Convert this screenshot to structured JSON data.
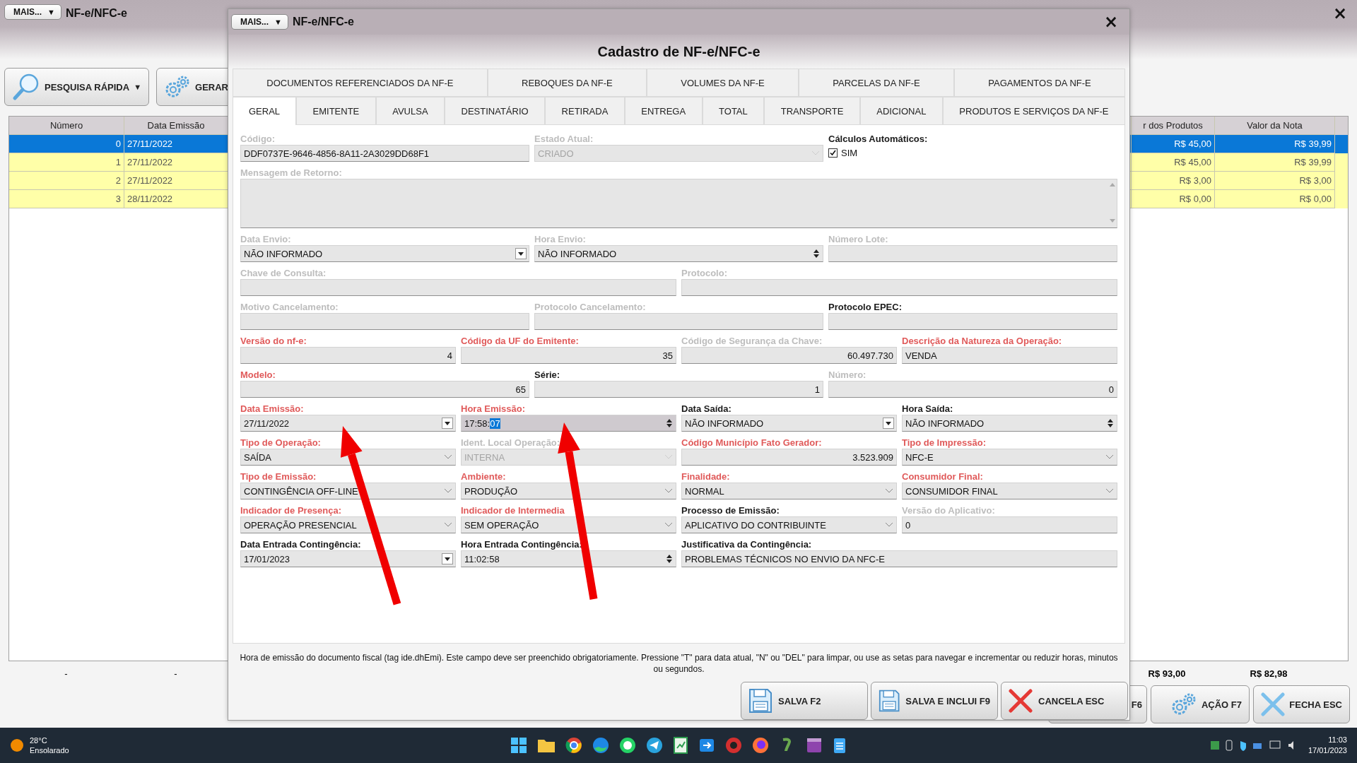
{
  "background_window": {
    "menu_button": "MAIS...",
    "menu_caret": "▼",
    "title": "NF-e/NFC-e",
    "close": "×",
    "toolbar": [
      {
        "kind": "search",
        "label": "PESQUISA RÁPIDA",
        "caret": "▼"
      },
      {
        "kind": "gear",
        "label": "GERAR"
      }
    ],
    "table": {
      "columns": [
        "Número",
        "Data Emissão",
        "r dos Produtos",
        "Valor da Nota"
      ],
      "rows": [
        {
          "number": "0",
          "date": "27/11/2022",
          "products": "R$ 45,00",
          "total": "R$ 39,99",
          "selected": true
        },
        {
          "number": "1",
          "date": "27/11/2022",
          "products": "R$ 45,00",
          "total": "R$ 39,99",
          "selected": false
        },
        {
          "number": "2",
          "date": "27/11/2022",
          "products": "R$ 3,00",
          "total": "R$ 3,00",
          "selected": false
        },
        {
          "number": "3",
          "date": "28/11/2022",
          "products": "R$ 0,00",
          "total": "R$ 0,00",
          "selected": false
        }
      ]
    },
    "totals": [
      "-",
      "-",
      "R$ 93,00",
      "R$ 82,98"
    ],
    "buttons": [
      {
        "kind": "plain",
        "label": "F6"
      },
      {
        "kind": "gear",
        "label": "AÇÃO F7"
      },
      {
        "kind": "close",
        "label": "FECHA ESC"
      }
    ]
  },
  "dialog": {
    "menu_button": "MAIS...",
    "menu_caret": "▼",
    "title": "NF-e/NFC-e",
    "close": "×",
    "heading": "Cadastro de NF-e/NFC-e",
    "tabs_top": [
      {
        "label": "DOCUMENTOS REFERENCIADOS DA NF-E",
        "selected": false
      },
      {
        "label": "REBOQUES DA NF-E",
        "selected": false
      },
      {
        "label": "VOLUMES DA NF-E",
        "selected": false
      },
      {
        "label": "PARCELAS DA NF-E",
        "selected": false
      },
      {
        "label": "PAGAMENTOS DA NF-E",
        "selected": false
      }
    ],
    "tabs": [
      {
        "label": "GERAL",
        "selected": true
      },
      {
        "label": "EMITENTE",
        "selected": false
      },
      {
        "label": "AVULSA",
        "selected": false
      },
      {
        "label": "DESTINATÁRIO",
        "selected": false
      },
      {
        "label": "RETIRADA",
        "selected": false
      },
      {
        "label": "ENTREGA",
        "selected": false
      },
      {
        "label": "TOTAL",
        "selected": false
      },
      {
        "label": "TRANSPORTE",
        "selected": false
      },
      {
        "label": "ADICIONAL",
        "selected": false
      },
      {
        "label": "PRODUTOS E SERVIÇOS DA NF-E",
        "selected": false
      }
    ],
    "form_rows": [
      [
        {
          "label": {
            "text": "Código:",
            "kind": "disabled"
          },
          "kind": "text",
          "value": "DDF0737E-9646-4856-8A11-2A3029DD68F1"
        },
        {
          "label": {
            "text": "Estado Atual:",
            "kind": "disabled"
          },
          "kind": "combo",
          "value": "CRIADO",
          "disabled": true
        },
        {
          "label": {
            "text": "Cálculos Automáticos:",
            "kind": "normal"
          },
          "kind": "checkbox",
          "option": "SIM",
          "checked": true
        }
      ],
      [
        {
          "label": {
            "text": "Mensagem de Retorno:",
            "kind": "disabled"
          },
          "kind": "memo"
        }
      ],
      [
        {
          "label": {
            "text": "Data Envio:",
            "kind": "disabled"
          },
          "kind": "date",
          "value": "NÃO INFORMADO"
        },
        {
          "label": {
            "text": "Hora Envio:",
            "kind": "disabled"
          },
          "kind": "spin",
          "value": "NÃO INFORMADO"
        },
        {
          "label": {
            "text": "Número Lote:",
            "kind": "disabled"
          },
          "kind": "text"
        }
      ],
      [
        {
          "label": {
            "text": "Chave de Consulta:",
            "kind": "disabled"
          },
          "kind": "text"
        },
        {
          "label": {
            "text": "Protocolo:",
            "kind": "disabled"
          },
          "kind": "text"
        }
      ],
      [
        {
          "label": {
            "text": "Motivo Cancelamento:",
            "kind": "disabled"
          },
          "kind": "text"
        },
        {
          "label": {
            "text": "Protocolo Cancelamento:",
            "kind": "disabled"
          },
          "kind": "text"
        },
        {
          "label": {
            "text": "Protocolo EPEC:",
            "kind": "normal"
          },
          "kind": "text"
        }
      ],
      [
        {
          "label": {
            "text": "Versão do nf-e:",
            "kind": "required"
          },
          "kind": "number",
          "value": "4"
        },
        {
          "label": {
            "text": "Código da UF do Emitente:",
            "kind": "required"
          },
          "kind": "number",
          "value": "35"
        },
        {
          "label": {
            "text": "Código de Segurança da Chave:",
            "kind": "disabled"
          },
          "kind": "number",
          "value": "60.497.730"
        },
        {
          "label": {
            "text": "Descrição da Natureza da Operação:",
            "kind": "required"
          },
          "kind": "text",
          "value": "VENDA"
        }
      ],
      [
        {
          "label": {
            "text": "Modelo:",
            "kind": "required"
          },
          "kind": "number",
          "value": "65"
        },
        {
          "label": {
            "text": "Série:",
            "kind": "normal"
          },
          "kind": "number",
          "value": "1"
        },
        {
          "label": {
            "text": "Número:",
            "kind": "disabled"
          },
          "kind": "number",
          "value": "0"
        }
      ],
      [
        {
          "label": {
            "text": "Data Emissão:",
            "kind": "required"
          },
          "kind": "date",
          "value": "27/11/2022"
        },
        {
          "label": {
            "text": "Hora Emissão:",
            "kind": "required"
          },
          "kind": "spin",
          "value": "17:58:",
          "selection": "07",
          "focused": true
        },
        {
          "label": {
            "text": "Data Saída:",
            "kind": "normal"
          },
          "kind": "date",
          "value": "NÃO INFORMADO"
        },
        {
          "label": {
            "text": "Hora Saída:",
            "kind": "normal"
          },
          "kind": "spin",
          "value": "NÃO INFORMADO"
        }
      ],
      [
        {
          "label": {
            "text": "Tipo de Operação:",
            "kind": "required"
          },
          "kind": "combo",
          "value": "SAÍDA"
        },
        {
          "label": {
            "text": "Ident. Local Operação:",
            "kind": "disabled"
          },
          "kind": "combo",
          "value": "INTERNA",
          "disabled": true
        },
        {
          "label": {
            "text": "Código Município Fato Gerador:",
            "kind": "required"
          },
          "kind": "number",
          "value": "3.523.909"
        },
        {
          "label": {
            "text": "Tipo de Impressão:",
            "kind": "required"
          },
          "kind": "combo",
          "value": "NFC-E"
        }
      ],
      [
        {
          "label": {
            "text": "Tipo de Emissão:",
            "kind": "required"
          },
          "kind": "combo",
          "value": "CONTINGÊNCIA OFF-LINE"
        },
        {
          "label": {
            "text": "Ambiente:",
            "kind": "required"
          },
          "kind": "combo",
          "value": "PRODUÇÃO"
        },
        {
          "label": {
            "text": "Finalidade:",
            "kind": "required"
          },
          "kind": "combo",
          "value": "NORMAL"
        },
        {
          "label": {
            "text": "Consumidor Final:",
            "kind": "required"
          },
          "kind": "combo",
          "value": "CONSUMIDOR FINAL"
        }
      ],
      [
        {
          "label": {
            "text": "Indicador de Presença:",
            "kind": "required"
          },
          "kind": "combo",
          "value": "OPERAÇÃO PRESENCIAL"
        },
        {
          "label": {
            "text": "Indicador de Intermedia",
            "kind": "required"
          },
          "kind": "combo",
          "value": "SEM OPERAÇÃO"
        },
        {
          "label": {
            "text": "Processo de Emissão:",
            "kind": "normal"
          },
          "kind": "combo",
          "value": "APLICATIVO DO CONTRIBUINTE"
        },
        {
          "label": {
            "text": "Versão do Aplicativo:",
            "kind": "disabled"
          },
          "kind": "text",
          "value": "0"
        }
      ],
      [
        {
          "label": {
            "text": "Data Entrada Contingência:",
            "kind": "normal"
          },
          "kind": "date",
          "value": "17/01/2023"
        },
        {
          "label": {
            "text": "Hora Entrada Contingência:",
            "kind": "normal"
          },
          "kind": "spin",
          "value": "11:02:58"
        },
        {
          "label": {
            "text": "Justificativa da Contingência:",
            "kind": "normal"
          },
          "kind": "text",
          "value": "PROBLEMAS TÉCNICOS NO ENVIO DA NFC-E",
          "wide": true
        }
      ]
    ],
    "help": "Hora de emissão do documento fiscal (tag ide.dhEmi). Este campo deve ser preenchido obrigatoriamente. Pressione \"T\" para data atual, \"N\" ou \"DEL\" para limpar, ou use as setas para navegar e incrementar ou reduzir horas, minutos ou segundos.",
    "buttons": [
      {
        "kind": "save",
        "label": "SALVA F2"
      },
      {
        "kind": "save",
        "label": "SALVA E INCLUI F9"
      },
      {
        "kind": "cancel",
        "label": "CANCELA ESC"
      }
    ]
  },
  "taskbar": {
    "temperature": "28°C",
    "condition": "Ensolarado",
    "time": "11:03",
    "date": "17/01/2023"
  }
}
